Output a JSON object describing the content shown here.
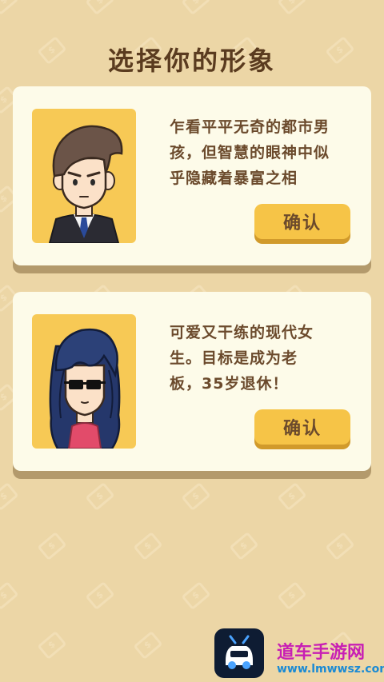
{
  "screen": {
    "title": "选择你的形象"
  },
  "characters": [
    {
      "id": "male",
      "description": "乍看平平无奇的都市男\n孩，但智慧的眼神中似\n乎隐藏着暴富之相",
      "confirm_label": "确认",
      "portrait_icon": "businessman-avatar-icon"
    },
    {
      "id": "female",
      "description": "可爱又干练的现代女\n生。目标是成为老\n板，35岁退休！",
      "confirm_label": "确认",
      "portrait_icon": "sunglasses-woman-avatar-icon"
    }
  ],
  "watermark": {
    "title": "道车手游网",
    "url": "www.lmwwsz.com"
  },
  "colors": {
    "background": "#ecd6a6",
    "card": "#fdfbe9",
    "portrait_bg": "#f7c955",
    "button": "#f6c447",
    "text": "#6b4a2c",
    "title": "#5a3b1f"
  }
}
